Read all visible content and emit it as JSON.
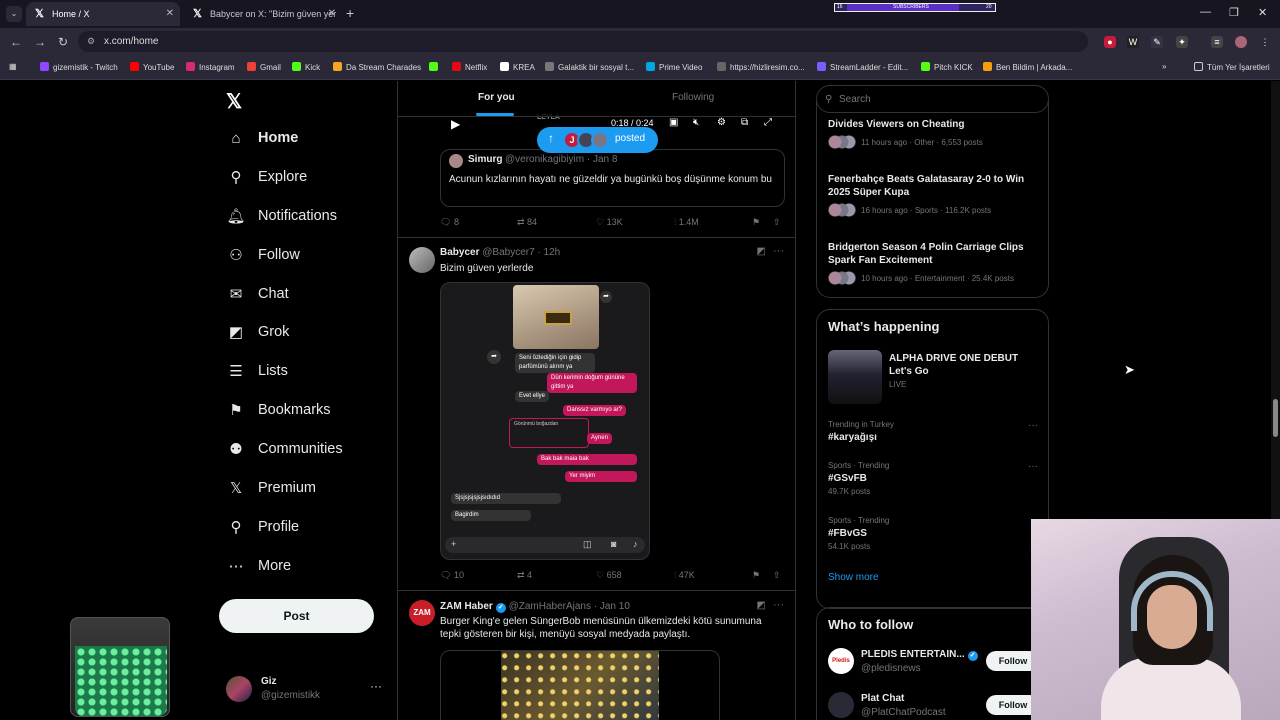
{
  "browser": {
    "tabs": [
      {
        "title": "Home / X",
        "active": true
      },
      {
        "title": "Babycer on X: \"Bizim güven yer",
        "active": false
      }
    ],
    "subscribers_bar": {
      "left": "16",
      "label": "SUBSCRIBERS",
      "right": "20",
      "progress": 0.8
    },
    "url": "x.com/home",
    "bookmarks": [
      "gizemistik - Twitch",
      "YouTube",
      "Instagram",
      "Gmail",
      "Kick",
      "Da Stream Charades",
      "Netflix",
      "KREA",
      "Galaktik bir sosyal t...",
      "Prime Video",
      "https://hizliresim.co...",
      "StreamLadder - Edit...",
      "Pitch KICK",
      "Ben Bildim | Arkada..."
    ],
    "all_bookmarks": "Tüm Yer İşaretleri"
  },
  "sidebar": {
    "nav": [
      {
        "label": "Home",
        "icon": "home-icon",
        "active": true
      },
      {
        "label": "Explore",
        "icon": "search-icon"
      },
      {
        "label": "Notifications",
        "icon": "bell-icon"
      },
      {
        "label": "Follow",
        "icon": "person-add-icon"
      },
      {
        "label": "Chat",
        "icon": "mail-icon"
      },
      {
        "label": "Grok",
        "icon": "grok-icon"
      },
      {
        "label": "Lists",
        "icon": "list-icon"
      },
      {
        "label": "Bookmarks",
        "icon": "bookmark-icon"
      },
      {
        "label": "Communities",
        "icon": "people-icon"
      },
      {
        "label": "Premium",
        "icon": "x-logo-icon"
      },
      {
        "label": "Profile",
        "icon": "person-icon"
      },
      {
        "label": "More",
        "icon": "more-circle-icon"
      }
    ],
    "post_button": "Post",
    "account": {
      "name": "Giz",
      "handle": "@gizemistikk"
    }
  },
  "feed": {
    "tabs": {
      "for_you": "For you",
      "following": "Following"
    },
    "video": {
      "time": "0:18 / 0:24",
      "overlay_text": "LEYLA"
    },
    "posted_pill": {
      "label": "posted",
      "avatar_letter": "J"
    },
    "quote": {
      "name": "Simurg",
      "handle_date": "@veronikagibiyim · Jan 8",
      "text": "Acunun kızlarının hayatı ne güzeldir ya bugünkü boş düşünme konum bu"
    },
    "actions1": {
      "replies": "8",
      "reposts": "84",
      "likes": "13K",
      "views": "1.4M"
    },
    "tweet2": {
      "name": "Babycer",
      "handle_date": "@Babycer7 · 12h",
      "text": "Bizim güven yerlerde",
      "screenshot_messages": [
        "Seni özlediğin için gidip parfümünü alırım ya",
        "Dün kerimin doğum gününe gittim ya",
        "Evet ellye",
        "Danssız varmıyo ar?",
        "Görünmü boğazdan",
        "Aynen",
        "Bak bak maia bak",
        "Yer miyim",
        "Sjsjsjsjsjsjsıdıdıd",
        "Bagirdim"
      ]
    },
    "actions2": {
      "replies": "10",
      "reposts": "4",
      "likes": "658",
      "views": "47K"
    },
    "tweet3": {
      "name": "ZAM Haber",
      "handle_date": "@ZamHaberAjans · Jan 10",
      "avatar_text": "ZAM",
      "text": "Burger King'e gelen SüngerBob menüsünün ülkemizdeki kötü sunumuna tepki gösteren bir kişi, menüyü sosyal medyada paylaştı."
    }
  },
  "right": {
    "search_placeholder": "Search",
    "news": [
      {
        "title": "Divides Viewers on Cheating",
        "meta": "11 hours ago · Other · 6,553 posts"
      },
      {
        "title": "Fenerbahçe Beats Galatasaray 2-0 to Win 2025 Süper Kupa",
        "meta": "16 hours ago · Sports · 116.2K posts"
      },
      {
        "title": "Bridgerton Season 4 Polin Carriage Clips Spark Fan Excitement",
        "meta": "10 hours ago · Entertainment · 25.4K posts"
      }
    ],
    "happening": {
      "heading": "What’s happening",
      "featured": {
        "title": "ALPHA DRIVE ONE DEBUT Let's Go",
        "status": "LIVE"
      },
      "trends": [
        {
          "context": "Trending in Turkey",
          "name": "#karyağışı",
          "posts": ""
        },
        {
          "context": "Sports · Trending",
          "name": "#GSvFB",
          "posts": "49.7K posts"
        },
        {
          "context": "Sports · Trending",
          "name": "#FBvGS",
          "posts": "54.1K posts"
        }
      ],
      "show_more": "Show more"
    },
    "who_to_follow": {
      "heading": "Who to follow",
      "accounts": [
        {
          "name": "PLEDIS ENTERTAIN...",
          "handle": "@pledisnews",
          "button": "Follow",
          "verified": true
        },
        {
          "name": "Plat Chat",
          "handle": "@PlatChatPodcast",
          "button": "Follow",
          "verified": false
        }
      ]
    }
  },
  "colors": {
    "accent": "#1d9bf0",
    "background": "#000000",
    "chrome": "#2b2838"
  }
}
